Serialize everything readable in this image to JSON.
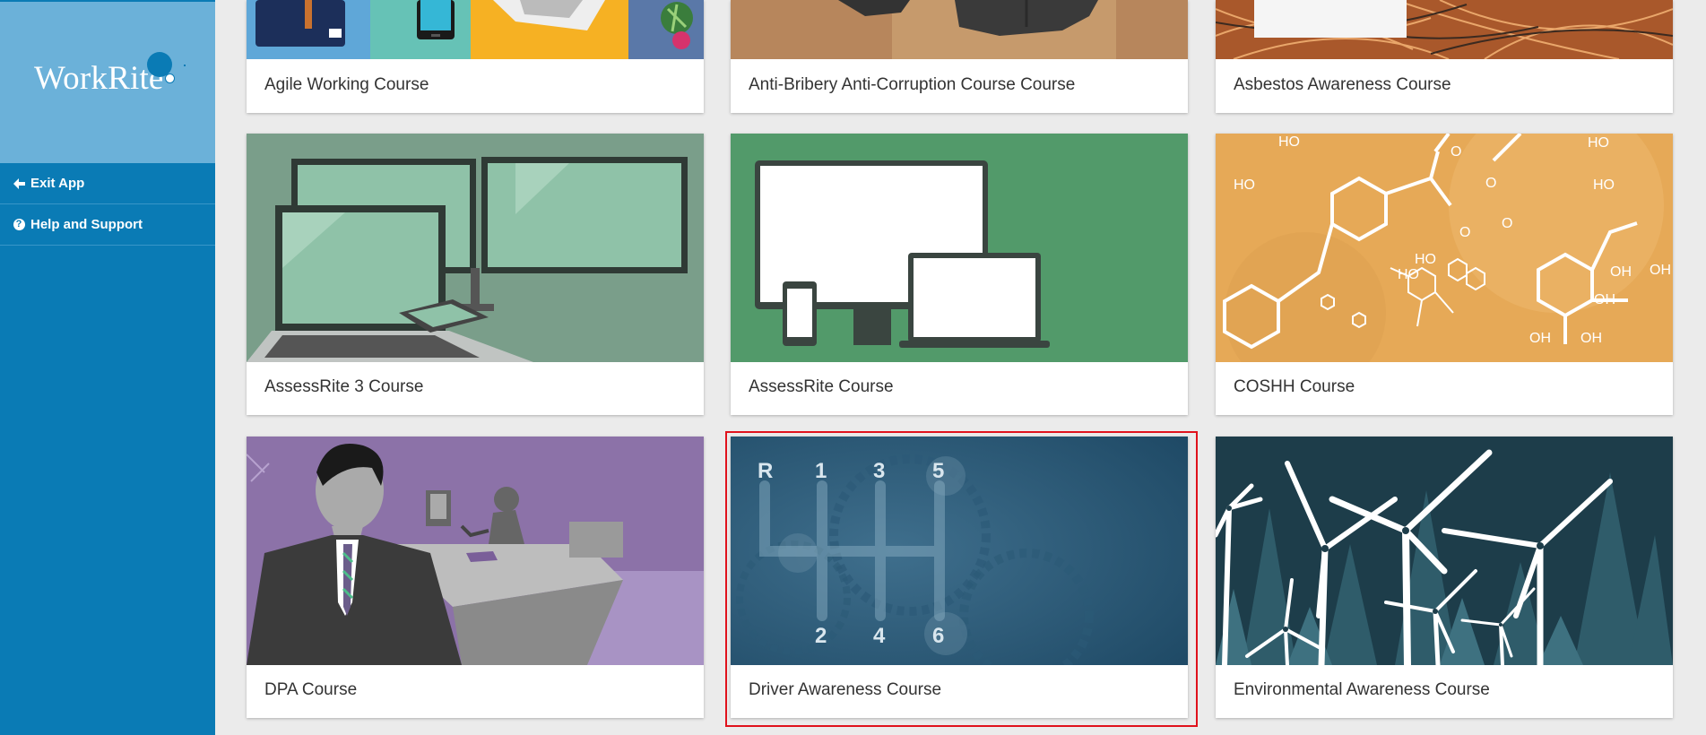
{
  "app": {
    "logo_text": "WorkRite"
  },
  "sidebar": {
    "items": [
      {
        "label": "Exit App",
        "icon": "arrow-left-icon"
      },
      {
        "label": "Help and Support",
        "icon": "question-circle-icon"
      }
    ]
  },
  "courses": [
    {
      "title": "Agile Working Course"
    },
    {
      "title": "Anti-Bribery Anti-Corruption Course Course"
    },
    {
      "title": "Asbestos Awareness Course"
    },
    {
      "title": "AssessRite 3 Course"
    },
    {
      "title": "AssessRite Course"
    },
    {
      "title": "COSHH Course"
    },
    {
      "title": "DPA Course"
    },
    {
      "title": "Driver Awareness Course",
      "selected": true
    },
    {
      "title": "Environmental Awareness Course"
    }
  ],
  "driver_gear_labels": [
    "R",
    "1",
    "3",
    "5",
    "2",
    "4",
    "6"
  ],
  "coshh_labels": [
    "HO",
    "HO",
    "O",
    "O",
    "HO",
    "HO",
    "O",
    "O",
    "OH",
    "OH",
    "OH",
    "OH",
    "OH",
    "HO",
    "HO"
  ],
  "colors": {
    "sidebar": "#0a7bb5",
    "logo_bg": "#6bb1d9",
    "selection": "#e0121c"
  }
}
